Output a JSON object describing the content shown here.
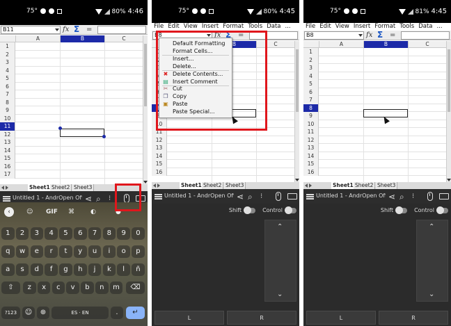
{
  "status_bar": {
    "p1": {
      "temp": "75°",
      "battery": "80%",
      "time": "4:46"
    },
    "p2": {
      "temp": "75°",
      "battery": "80%",
      "time": "4:45"
    },
    "p3": {
      "temp": "75°",
      "battery": "81%",
      "time": "4:45"
    }
  },
  "menu_bar": [
    "File",
    "Edit",
    "View",
    "Insert",
    "Format",
    "Tools",
    "Data",
    "..."
  ],
  "formula_bar": {
    "p1_cell": "B11",
    "p2_cell": "B8",
    "p3_cell": "B8",
    "fx_label": "fx",
    "sum_label": "Σ",
    "eq_label": "="
  },
  "columns": [
    "A",
    "B",
    "C"
  ],
  "rows": [
    "1",
    "2",
    "3",
    "4",
    "5",
    "6",
    "7",
    "8",
    "9",
    "10",
    "11",
    "12",
    "13",
    "14",
    "15",
    "16",
    "17"
  ],
  "sheet_tabs": [
    "Sheet1",
    "Sheet2",
    "Sheet3"
  ],
  "app_title": "Untitled 1 - AndrOpen Offi...",
  "context_menu": {
    "items": [
      {
        "label": "Default Formatting",
        "icon": ""
      },
      {
        "label": "Format Cells...",
        "icon": ""
      },
      {
        "label": "Insert...",
        "icon": ""
      },
      {
        "label": "Delete...",
        "icon": ""
      },
      {
        "label": "Delete Contents...",
        "icon": "delete-icon"
      },
      {
        "label": "Insert Comment",
        "icon": "comment-icon"
      },
      {
        "label": "Cut",
        "icon": "scissors-icon"
      },
      {
        "label": "Copy",
        "icon": "copy-icon"
      },
      {
        "label": "Paste",
        "icon": "paste-icon"
      },
      {
        "label": "Paste Special...",
        "icon": ""
      }
    ]
  },
  "touchpad": {
    "shift_label": "Shift",
    "control_label": "Control",
    "left_label": "L",
    "right_label": "R"
  },
  "keyboard": {
    "toolbar": [
      "GIF"
    ],
    "row1": [
      "1",
      "2",
      "3",
      "4",
      "5",
      "6",
      "7",
      "8",
      "9",
      "0"
    ],
    "row2": [
      "q",
      "w",
      "e",
      "r",
      "t",
      "y",
      "u",
      "i",
      "o",
      "p"
    ],
    "row3": [
      "a",
      "s",
      "d",
      "f",
      "g",
      "h",
      "j",
      "k",
      "l",
      "ñ"
    ],
    "row4": [
      "z",
      "x",
      "c",
      "v",
      "b",
      "n",
      "m"
    ],
    "sym_label": "?123",
    "space_label": "ES · EN"
  },
  "colors": {
    "selection_header": "#1c2aa8",
    "highlight_red": "#e0161c",
    "toolbar_dark": "#2d2d2d"
  }
}
